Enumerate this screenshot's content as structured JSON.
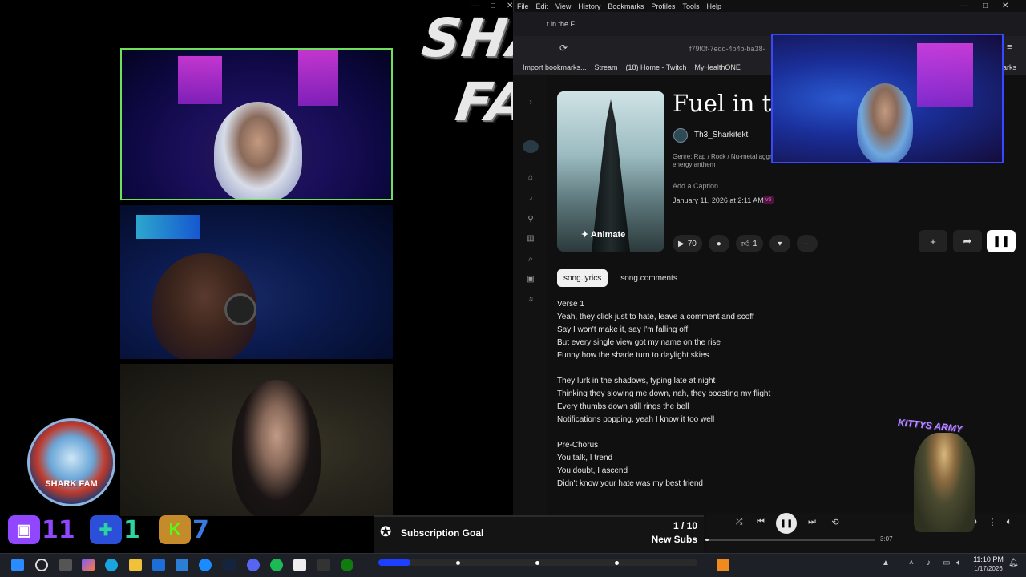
{
  "overlay": {
    "title": "SHARK FAM",
    "logo_text": "SHARK FAM",
    "army_label": "KITTYS ARMY",
    "social": [
      {
        "platform": "twitch",
        "glyph": "▣",
        "count": "11",
        "color": "#9146ff"
      },
      {
        "platform": "kick-green",
        "glyph": "✚",
        "count": "1",
        "color": "#2bd4a0"
      },
      {
        "platform": "kick",
        "glyph": "K",
        "count": "7",
        "color": "#53fc18"
      }
    ],
    "sub_goal": {
      "title": "Subscription Goal",
      "count": "1 / 10",
      "type": "New Subs",
      "progress": 0.1
    }
  },
  "browser": {
    "menu": [
      "File",
      "Edit",
      "View",
      "History",
      "Bookmarks",
      "Profiles",
      "Tools",
      "Help"
    ],
    "tab_fragment": "t in the F",
    "url_fragment": "f79f0f-7edd-4b4b-ba38-",
    "bookmarks": [
      "Import bookmarks...",
      "Stream",
      "(18) Home - Twitch",
      "MyHealthONE",
      "marks"
    ]
  },
  "song": {
    "title": "Fuel in the F",
    "artist": "Th3_Sharkitekt",
    "genre": "Genre: Rap / Rock / Nu-metal aggressive, high energy anthem",
    "caption_placeholder": "Add a Caption",
    "date": "January 11, 2026 at 2:11 AM",
    "version": "v5",
    "animate_label": "Animate",
    "plays": "70",
    "likes": "1",
    "tabs": [
      "song.lyrics",
      "song.comments"
    ],
    "lyrics": [
      "Verse 1",
      "Yeah, they click just to hate, leave a comment and scoff",
      "Say I won't make it, say I'm falling off",
      "But every single view got my name on the rise",
      "Funny how the shade turn to daylight skies",
      "",
      "They lurk in the shadows, typing late at night",
      "Thinking they slowing me down, nah, they boosting my flight",
      "Every thumbs down still rings the bell",
      "Notifications popping, yeah I know it too well",
      "",
      "Pre-Chorus",
      "You talk, I trend",
      "You doubt, I ascend",
      "Didn't know your hate was my best friend"
    ]
  },
  "player": {
    "duration": "3:07",
    "progress": 0.02
  },
  "taskbar": {
    "time": "11:10 PM",
    "date": "1/17/2026"
  }
}
